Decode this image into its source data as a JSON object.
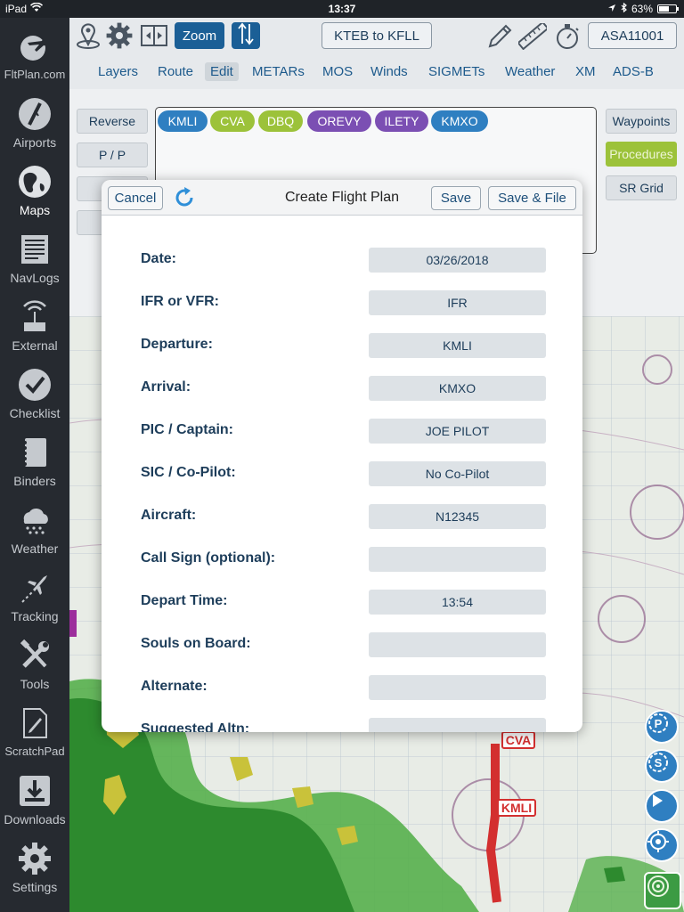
{
  "status_bar": {
    "device": "iPad",
    "time": "13:37",
    "battery": "63%",
    "battery_level": 0.63
  },
  "sidebar": {
    "items": [
      {
        "label": "FltPlan.com",
        "icon": "airplane-globe-icon"
      },
      {
        "label": "Airports",
        "icon": "runway-icon"
      },
      {
        "label": "Maps",
        "icon": "globe-icon"
      },
      {
        "label": "NavLogs",
        "icon": "document-lines-icon"
      },
      {
        "label": "External",
        "icon": "wifi-device-icon"
      },
      {
        "label": "Checklist",
        "icon": "checkmark-icon"
      },
      {
        "label": "Binders",
        "icon": "binder-icon"
      },
      {
        "label": "Weather",
        "icon": "rain-cloud-icon"
      },
      {
        "label": "Tracking",
        "icon": "tracking-plane-icon"
      },
      {
        "label": "Tools",
        "icon": "wrench-screwdriver-icon"
      },
      {
        "label": "ScratchPad",
        "icon": "pencil-paper-icon"
      },
      {
        "label": "Downloads",
        "icon": "download-icon"
      },
      {
        "label": "Settings",
        "icon": "gear-icon"
      }
    ]
  },
  "toolbar": {
    "zoom_label": "Zoom",
    "route_label": "KTEB to KFLL",
    "aircraft_label": "ASA11001"
  },
  "tabs": [
    "Layers",
    "Route",
    "Edit",
    "METARs",
    "MOS",
    "Winds",
    "SIGMETs",
    "Weather",
    "XM",
    "ADS-B"
  ],
  "edit_panel": {
    "reverse_label": "Reverse",
    "pp_label": "P / P",
    "waypoints_label": "Waypoints",
    "procedures_label": "Procedures",
    "srgrid_label": "SR Grid"
  },
  "route_waypoints": [
    {
      "label": "KMLI",
      "color": "#2f7fc1"
    },
    {
      "label": "CVA",
      "color": "#9cc23a"
    },
    {
      "label": "DBQ",
      "color": "#9cc23a"
    },
    {
      "label": "OREVY",
      "color": "#7b4fb3"
    },
    {
      "label": "ILETY",
      "color": "#7b4fb3"
    },
    {
      "label": "KMXO",
      "color": "#2f7fc1"
    }
  ],
  "modal": {
    "title": "Create Flight Plan",
    "cancel_label": "Cancel",
    "save_label": "Save",
    "save_file_label": "Save & File",
    "fields": [
      {
        "label": "Date:",
        "value": "03/26/2018"
      },
      {
        "label": "IFR or VFR:",
        "value": "IFR"
      },
      {
        "label": "Departure:",
        "value": "KMLI"
      },
      {
        "label": "Arrival:",
        "value": "KMXO"
      },
      {
        "label": "PIC / Captain:",
        "value": "JOE PILOT"
      },
      {
        "label": "SIC / Co-Pilot:",
        "value": "No Co-Pilot"
      },
      {
        "label": "Aircraft:",
        "value": "N12345"
      },
      {
        "label": "Call Sign (optional):",
        "value": ""
      },
      {
        "label": "Depart Time:",
        "value": "13:54"
      },
      {
        "label": "Souls on Board:",
        "value": ""
      },
      {
        "label": "Alternate:",
        "value": ""
      },
      {
        "label": "Suggested Altn:",
        "value": ""
      }
    ]
  },
  "map": {
    "labels": {
      "cva": "CVA",
      "kmli": "KMLI"
    }
  },
  "colors": {
    "accent_blue": "#1b5f96",
    "procedures_green": "#9cc23a",
    "route_red": "#d32f2f"
  }
}
